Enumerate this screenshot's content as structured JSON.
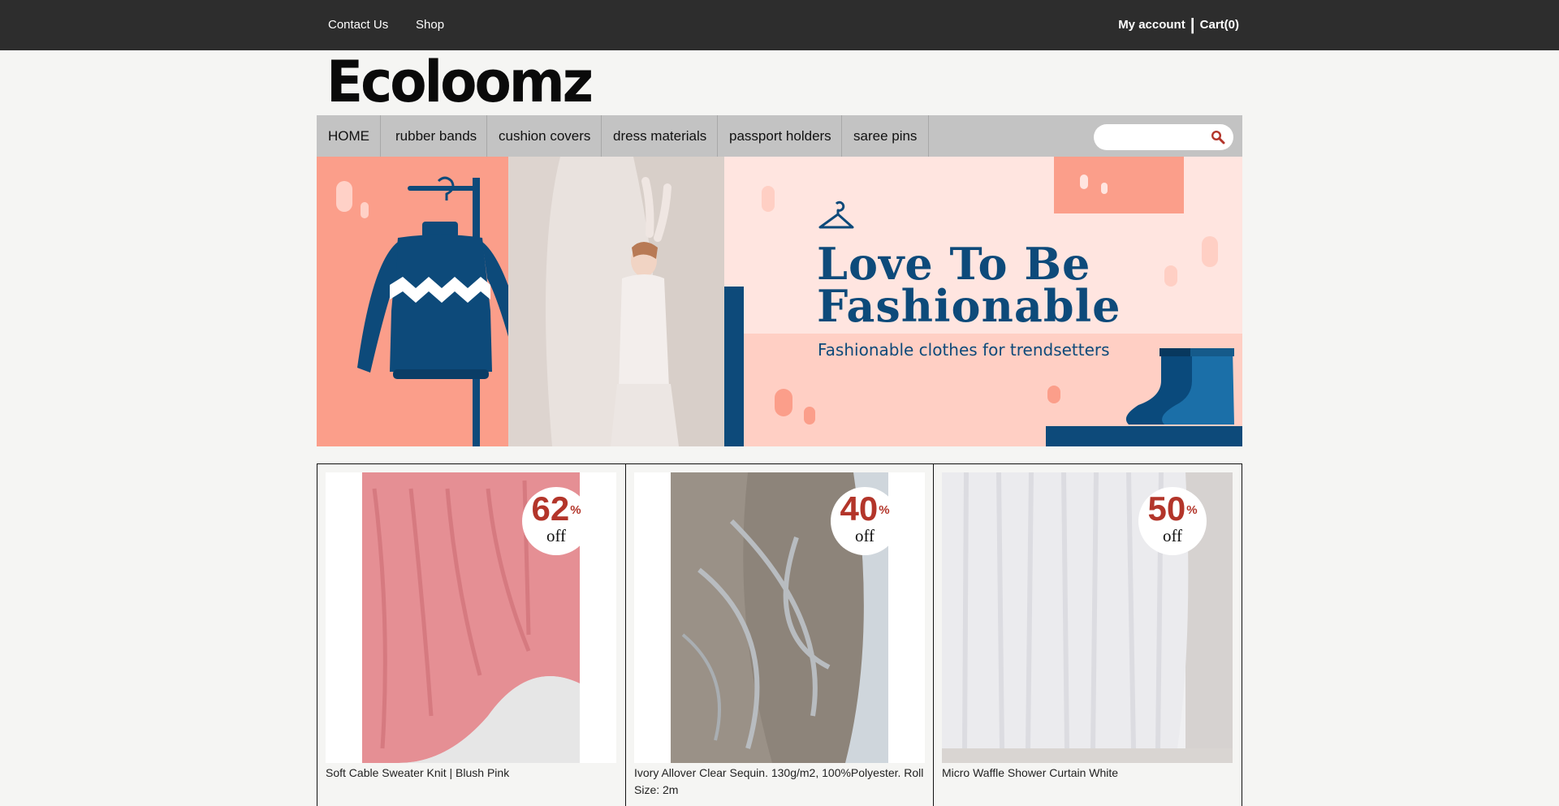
{
  "topbar": {
    "contact_label": "Contact Us",
    "shop_label": "Shop",
    "account_label": "My account",
    "separator": "|",
    "cart_label": "Cart(0)"
  },
  "site": {
    "logo_text": "Ecoloomz"
  },
  "nav": {
    "items": [
      "HOME",
      "rubber bands",
      "cushion covers",
      "dress materials",
      "passport holders",
      "saree pins"
    ],
    "search": {
      "value": "",
      "placeholder": ""
    }
  },
  "banner": {
    "title_line1": "Love To Be",
    "title_line2": "Fashionable",
    "subtitle": "Fashionable clothes for trendsetters"
  },
  "products": [
    {
      "name": "Soft Cable Sweater Knit | Blush Pink",
      "discount": "62",
      "percent_sign": "%",
      "off_label": "off"
    },
    {
      "name": "Ivory Allover Clear Sequin. 130g/m2, 100%Polyester. Roll Size: 2m",
      "discount": "40",
      "percent_sign": "%",
      "off_label": "off"
    },
    {
      "name": "Micro Waffle Shower Curtain White",
      "discount": "50",
      "percent_sign": "%",
      "off_label": "off"
    }
  ],
  "colors": {
    "topbar_bg": "#2d2d2d",
    "nav_bg": "#c3c3c3",
    "banner_navy": "#0d4a7a",
    "banner_salmon": "#fb9e8a",
    "banner_pink": "#ffe5e0",
    "discount_red": "#b3352a"
  },
  "icons": {
    "search": "magnifier-icon",
    "banner_hanger": "hanger-icon"
  }
}
